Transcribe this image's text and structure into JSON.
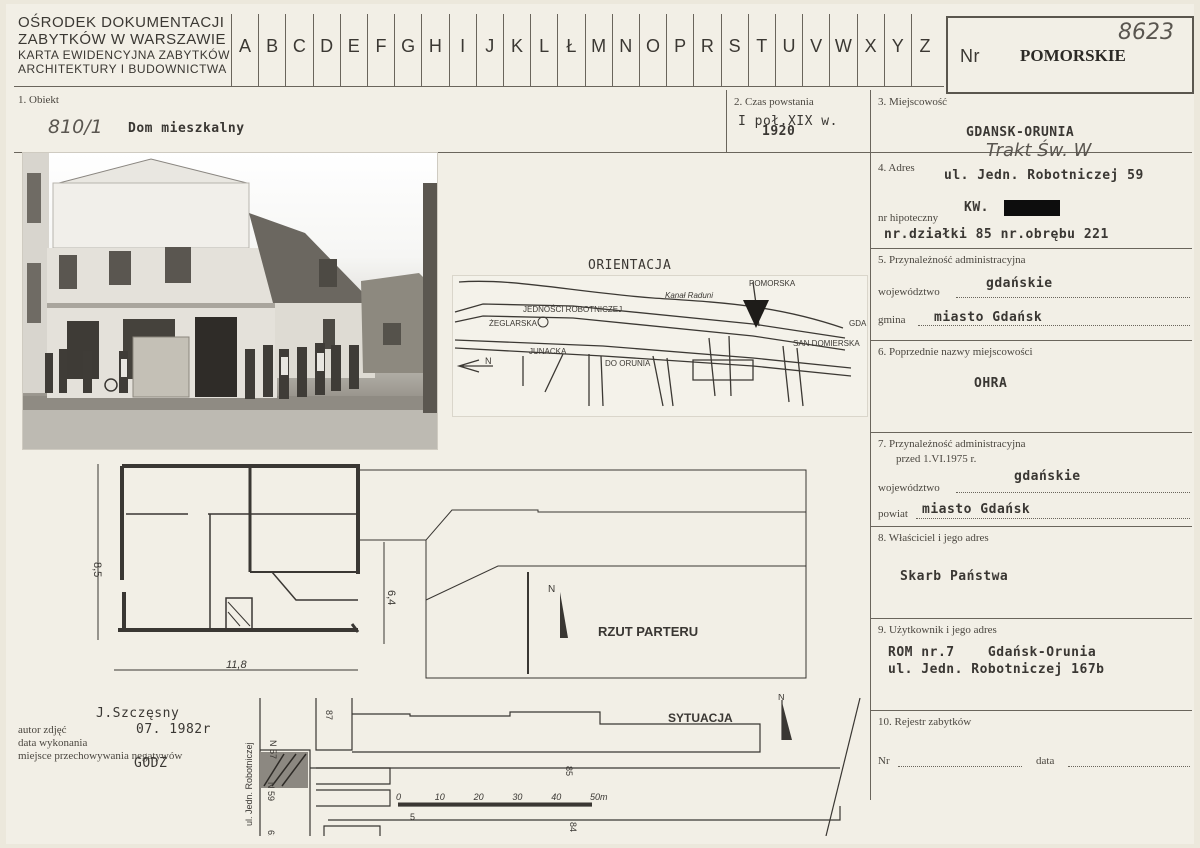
{
  "header": {
    "institution_lines": [
      "OŚRODEK DOKUMENTACJI",
      "ZABYTKÓW W WARSZAWIE",
      "KARTA EWIDENCYJNA ZABYTKÓW",
      "ARCHITEKTURY I BUDOWNICTWA"
    ],
    "letters": [
      "A",
      "B",
      "C",
      "D",
      "E",
      "F",
      "G",
      "H",
      "I",
      "J",
      "K",
      "L",
      "Ł",
      "M",
      "N",
      "O",
      "P",
      "R",
      "S",
      "T",
      "U",
      "V",
      "W",
      "X",
      "Y",
      "Z"
    ],
    "nr_label": "Nr",
    "region": "POMORSKIE",
    "card_number": "8623"
  },
  "fields": {
    "obiekt": {
      "label": "1. Obiekt",
      "handwritten_code": "810/1",
      "value": "Dom mieszkalny"
    },
    "czas": {
      "label": "2. Czas powstania",
      "value_line1": "I poł.XIX w.",
      "value_line2": "1920"
    },
    "miejscowosc": {
      "label": "3. Miejscowość",
      "value": "GDANSK-ORUNIA"
    },
    "adres": {
      "label": "4. Adres",
      "handwritten": "Trakt Św. W",
      "street": "ul. Jedn. Robotniczej 59",
      "kw_label": "KW.",
      "hipoteczny_label": "nr hipoteczny",
      "dzialka": "nr.działki 85 nr.obrębu 221"
    },
    "przynaleznosc": {
      "label": "5. Przynależność administracyjna",
      "wojewodztwo_label": "województwo",
      "wojewodztwo": "gdańskie",
      "gmina_label": "gmina",
      "gmina": "miasto Gdańsk"
    },
    "poprzednie": {
      "label": "6. Poprzednie nazwy miejscowości",
      "value": "OHRA"
    },
    "przynaleznosc_przed": {
      "label": "7. Przynależność administracyjna",
      "label2": "przed 1.VI.1975 r.",
      "wojewodztwo_label": "województwo",
      "wojewodztwo": "gdańskie",
      "powiat_label": "powiat",
      "powiat": "miasto Gdańsk"
    },
    "wlasciciel": {
      "label": "8. Właściciel i jego adres",
      "value": "Skarb Państwa"
    },
    "uzytkownik": {
      "label": "9. Użytkownik i jego adres",
      "line1": "ROM nr.7    Gdańsk-Orunia",
      "line2": "ul. Jedn. Robotniczej 167b"
    },
    "rejestr": {
      "label": "10. Rejestr zabytków",
      "nr_label": "Nr",
      "data_label": "data"
    }
  },
  "map": {
    "title": "ORIENTACJA",
    "streets": [
      "JEDNOŚCI ROBOTNICZEJ",
      "Kanał Raduni",
      "POMORSKA",
      "GDAŃSK",
      "JUNACKA",
      "SAN DOMIERSKA",
      "DO ORUNIA",
      "ŻEGLARSKA",
      "N"
    ]
  },
  "plan": {
    "title": "RZUT PARTERU",
    "dim_height": "8,5",
    "dim_width": "11,8",
    "dim_inner": "6,4",
    "north": "N"
  },
  "situation": {
    "title": "SYTUACJA",
    "street_label": "ul. Jedn. Robotniczej",
    "parcel_labels": [
      "N 57",
      "N 59",
      "61",
      "87",
      "85",
      "84",
      "5"
    ],
    "scale": [
      "0",
      "10",
      "20",
      "30",
      "40",
      "50m"
    ],
    "north": "N"
  },
  "photo_meta": {
    "author_label": "autor zdjęć",
    "author": "J.Szczęsny",
    "date_label": "data wykonania",
    "date": "07. 1982r",
    "place_label": "miejsce przechowywania negatywów",
    "place": "GODZ"
  }
}
